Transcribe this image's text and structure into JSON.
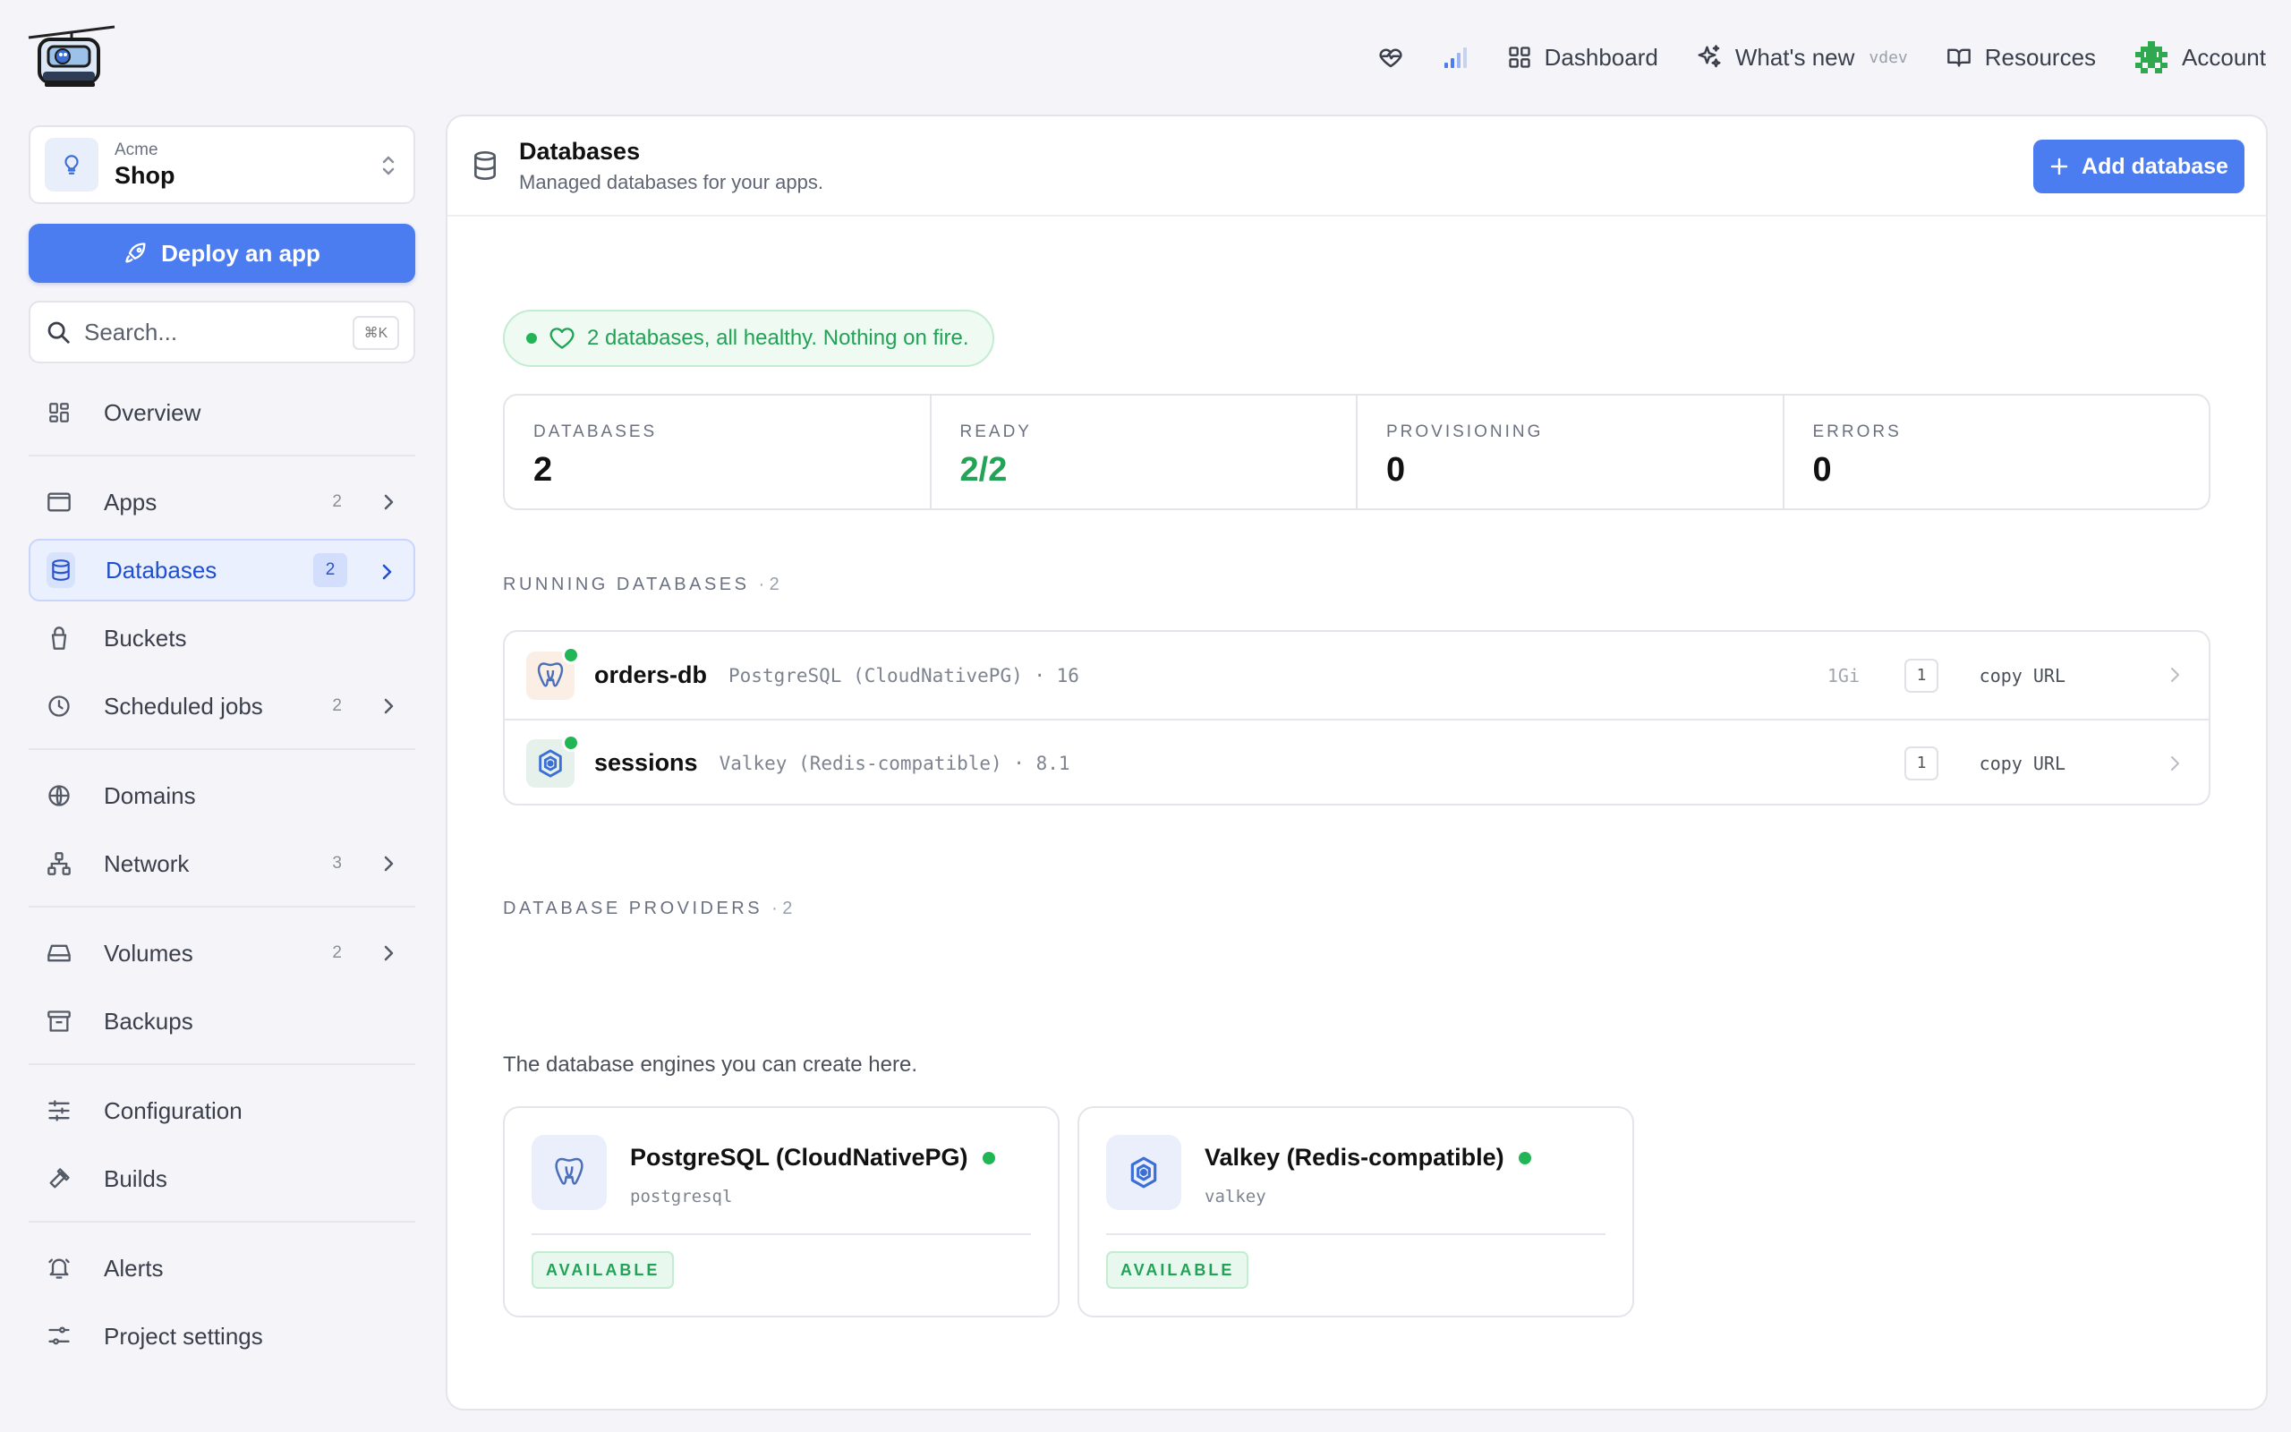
{
  "topnav": {
    "dashboard": "Dashboard",
    "whats_new": "What's new",
    "version": "vdev",
    "resources": "Resources",
    "account": "Account"
  },
  "project": {
    "org": "Acme",
    "name": "Shop"
  },
  "sidebar": {
    "deploy_label": "Deploy an app",
    "search_placeholder": "Search...",
    "search_shortcut": "⌘K",
    "items": {
      "overview": {
        "label": "Overview"
      },
      "apps": {
        "label": "Apps",
        "count": "2"
      },
      "databases": {
        "label": "Databases",
        "count": "2"
      },
      "buckets": {
        "label": "Buckets"
      },
      "scheduled_jobs": {
        "label": "Scheduled jobs",
        "count": "2"
      },
      "domains": {
        "label": "Domains"
      },
      "network": {
        "label": "Network",
        "count": "3"
      },
      "volumes": {
        "label": "Volumes",
        "count": "2"
      },
      "backups": {
        "label": "Backups"
      },
      "configuration": {
        "label": "Configuration"
      },
      "builds": {
        "label": "Builds"
      },
      "alerts": {
        "label": "Alerts"
      },
      "project_settings": {
        "label": "Project settings"
      }
    }
  },
  "main": {
    "title": "Databases",
    "subtitle": "Managed databases for your apps.",
    "add_label": "Add database",
    "health_message": "2 databases, all healthy. Nothing on fire.",
    "stats": [
      {
        "label": "DATABASES",
        "value": "2"
      },
      {
        "label": "READY",
        "value": "2/2"
      },
      {
        "label": "PROVISIONING",
        "value": "0"
      },
      {
        "label": "ERRORS",
        "value": "0"
      }
    ],
    "running": {
      "heading": "RUNNING DATABASES",
      "count": "· 2",
      "rows": [
        {
          "name": "orders-db",
          "meta": "PostgreSQL (CloudNativePG) · 16",
          "size": "1Gi",
          "replicas": "1",
          "copy": "copy URL"
        },
        {
          "name": "sessions",
          "meta": "Valkey (Redis-compatible) · 8.1",
          "size": "",
          "replicas": "1",
          "copy": "copy URL"
        }
      ]
    },
    "providers": {
      "heading": "DATABASE PROVIDERS",
      "count": "· 2",
      "description": "The database engines you can create here.",
      "items": [
        {
          "name": "PostgreSQL (CloudNativePG)",
          "id": "postgresql",
          "status": "AVAILABLE"
        },
        {
          "name": "Valkey (Redis-compatible)",
          "id": "valkey",
          "status": "AVAILABLE"
        }
      ]
    }
  },
  "colors": {
    "accent": "#4b7cf0",
    "success": "#22b556"
  }
}
